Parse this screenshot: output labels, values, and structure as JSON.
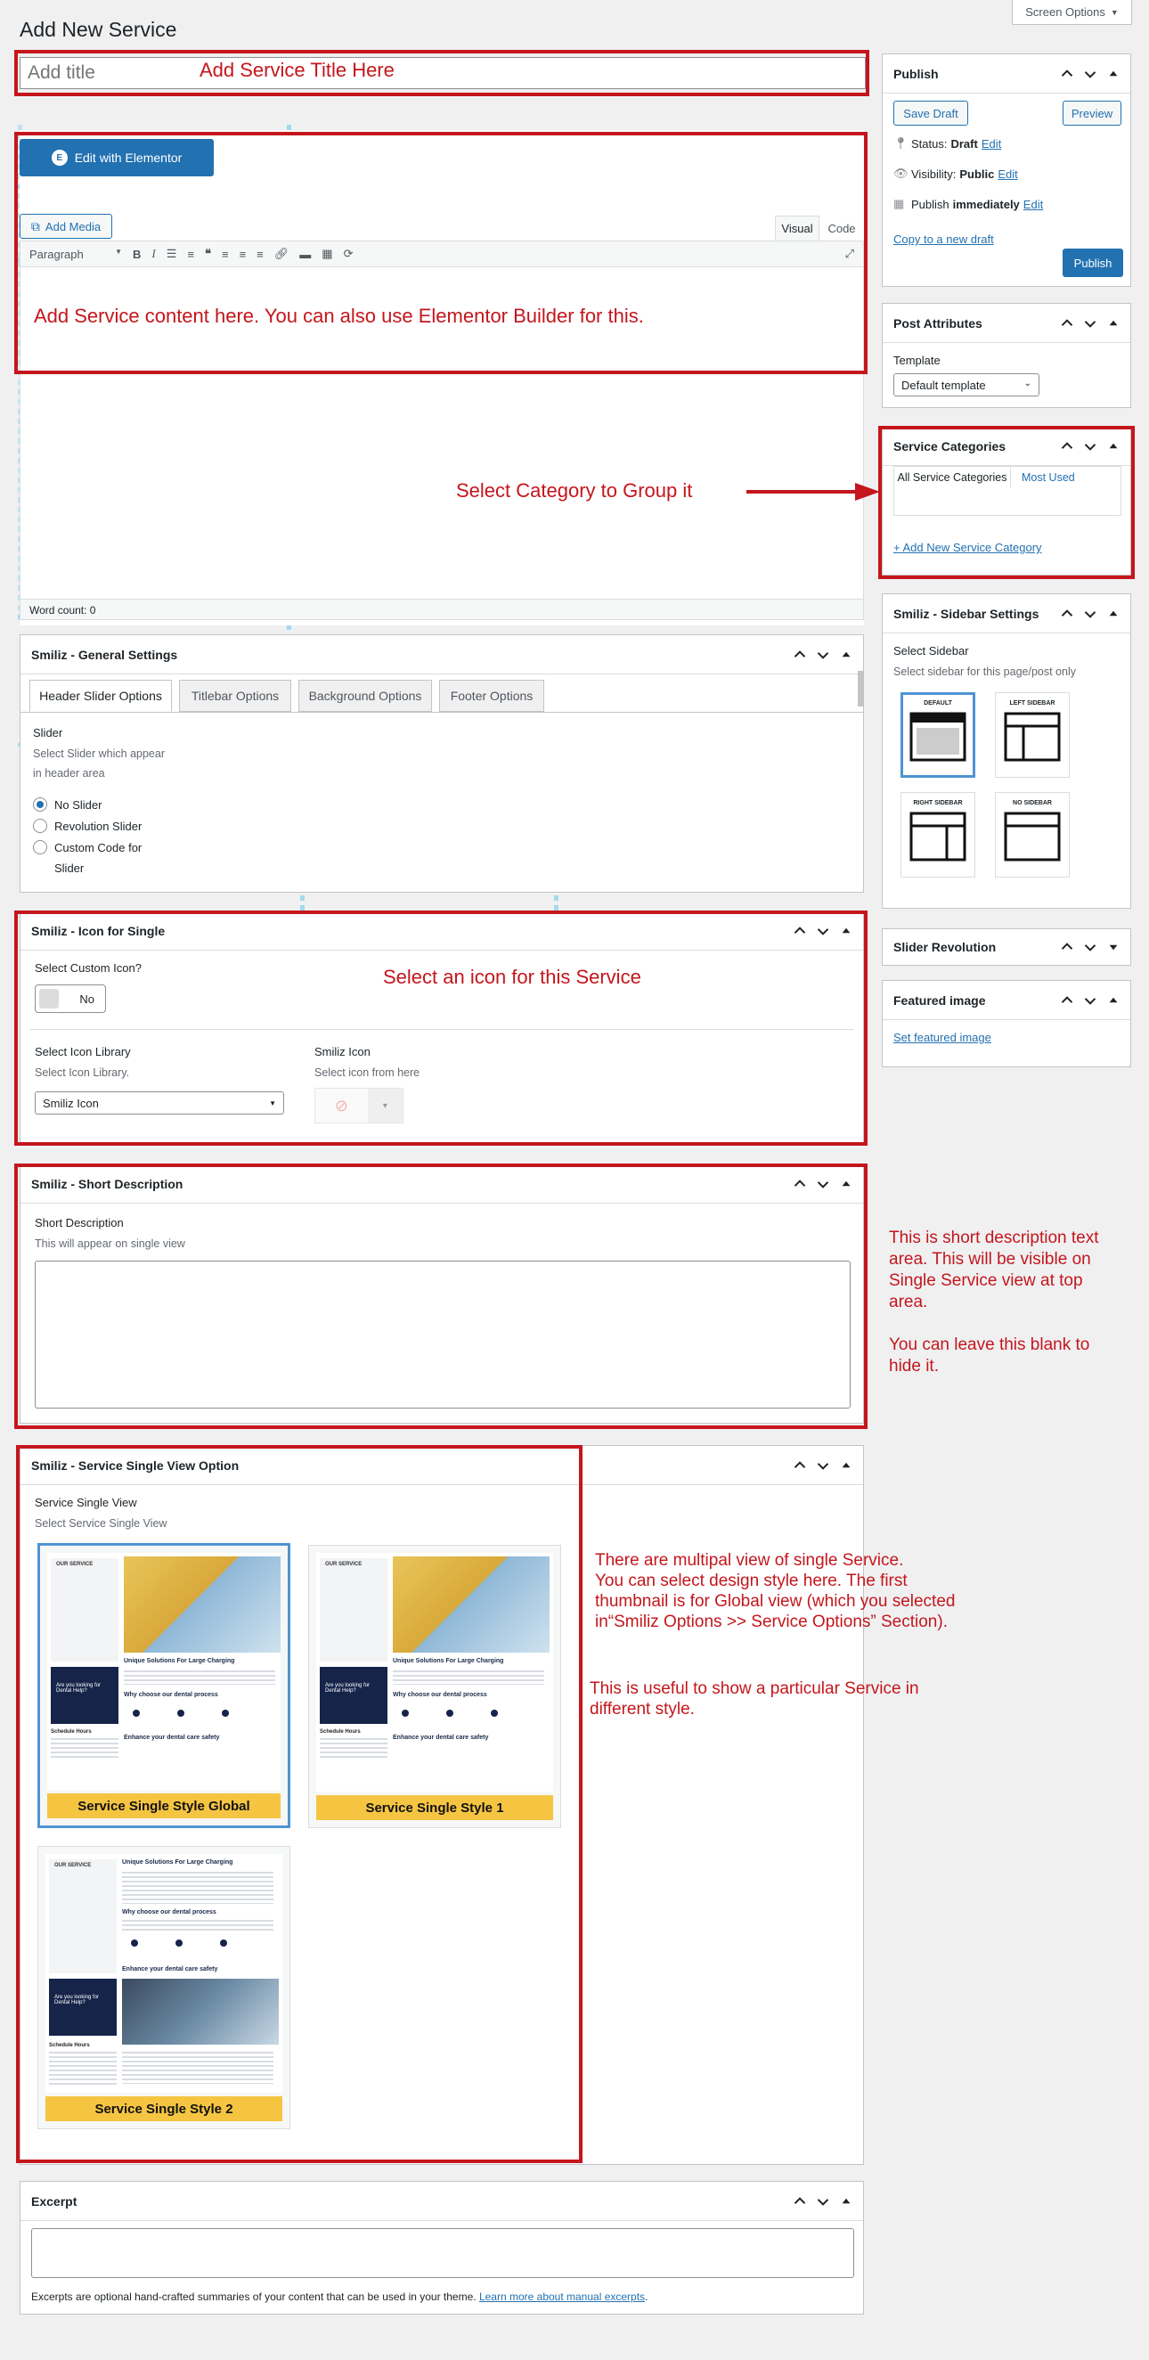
{
  "page": {
    "title": "Add New Service",
    "screen_options": "Screen Options"
  },
  "title_field": {
    "placeholder": "Add title"
  },
  "annotations": {
    "title": "Add Service Title Here",
    "content": "Add Service content here. You can also use Elementor Builder for this.",
    "category": "Select Category to Group it",
    "icon": "Select an icon for this Service",
    "short_desc": [
      "This is short description text",
      "area. This will be visible on",
      "Single Service view at top",
      "area.",
      "",
      "You can leave this blank to",
      "hide it."
    ],
    "single_view_1": [
      "There are multipal view of single Service.",
      "You can select design style here. The first",
      "thumbnail is for Global view (which you selected",
      "in“Smiliz Options >> Service Options” Section)."
    ],
    "single_view_2": [
      "This is useful to show a particular Service in",
      "different style."
    ]
  },
  "editor": {
    "elementor_btn": "Edit with Elementor",
    "add_media": "Add Media",
    "tab_visual": "Visual",
    "tab_code": "Code",
    "format": "Paragraph",
    "word_count": "Word count: 0"
  },
  "general": {
    "title": "Smiliz - General Settings",
    "tabs": [
      "Header Slider Options",
      "Titlebar Options",
      "Background Options",
      "Footer Options"
    ],
    "slider_label": "Slider",
    "slider_desc": [
      "Select Slider which appear",
      "in header area"
    ],
    "options": [
      "No Slider",
      "Revolution Slider",
      "Custom Code for",
      "Slider"
    ]
  },
  "icon_box": {
    "title": "Smiliz - Icon for Single",
    "custom_label": "Select Custom Icon?",
    "toggle": "No",
    "lib_label": "Select Icon Library",
    "lib_desc": "Select Icon Library.",
    "lib_value": "Smiliz Icon",
    "icon_label": "Smiliz Icon",
    "icon_desc": "Select icon from here"
  },
  "short": {
    "title": "Smiliz - Short Description",
    "label": "Short Description",
    "desc": "This will appear on single view"
  },
  "single": {
    "title": "Smiliz - Service Single View Option",
    "label": "Service Single View",
    "desc": "Select Service Single View",
    "thumbs": [
      {
        "caption": "Service Single Style Global"
      },
      {
        "caption": "Service Single Style 1"
      },
      {
        "caption": "Service Single Style 2"
      }
    ],
    "mock": {
      "sidebar": "OUR SERVICE",
      "heading": "Unique Solutions For Large Charging",
      "process": "Why choose our dental process",
      "cta": "Are you looking for Dental Help?",
      "hours": "Schedule Hours",
      "enhance": "Enhance your dental care safety"
    }
  },
  "excerpt": {
    "title": "Excerpt",
    "desc": "Excerpts are optional hand-crafted summaries of your content that can be used in your theme.",
    "link": "Learn more about manual excerpts"
  },
  "publish": {
    "title": "Publish",
    "save_draft": "Save Draft",
    "preview": "Preview",
    "status_label": "Status:",
    "status_value": "Draft",
    "visibility_label": "Visibility:",
    "visibility_value": "Public",
    "publish_label": "Publish",
    "publish_value": "immediately",
    "edit": "Edit",
    "copy": "Copy to a new draft",
    "publish_btn": "Publish"
  },
  "attributes": {
    "title": "Post Attributes",
    "template_label": "Template",
    "template_value": "Default template"
  },
  "categories": {
    "title": "Service Categories",
    "tab_all": "All Service Categories",
    "tab_used": "Most Used",
    "add": "+ Add New Service Category"
  },
  "sidebar_settings": {
    "title": "Smiliz - Sidebar Settings",
    "label": "Select Sidebar",
    "desc": "Select sidebar for this page/post only",
    "options": [
      "DEFAULT",
      "LEFT SIDEBAR",
      "RIGHT SIDEBAR",
      "NO SIDEBAR"
    ]
  },
  "slider_rev": {
    "title": "Slider Revolution"
  },
  "featured": {
    "title": "Featured image",
    "link": "Set featured image"
  },
  "colors": {
    "accent": "#2271b1",
    "annotation": "#c4161c",
    "caption": "#f5c542"
  }
}
